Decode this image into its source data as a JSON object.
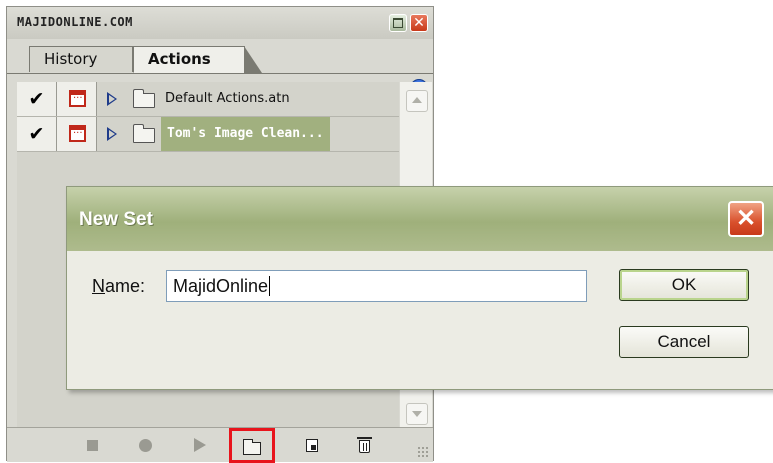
{
  "palette": {
    "title": "MAJIDONLINE.COM",
    "close_glyph": "✕",
    "tabs": [
      {
        "label": "History",
        "active": false
      },
      {
        "label": "Actions",
        "active": true
      }
    ],
    "rows": [
      {
        "checked": true,
        "check_glyph": "✔",
        "dialog_icon": "dialog-toggle-icon",
        "label": "Default Actions.atn",
        "selected": false
      },
      {
        "checked": true,
        "check_glyph": "✔",
        "dialog_icon": "dialog-toggle-icon",
        "label": "Tom's Image Clean...",
        "selected": true
      }
    ],
    "toolbar": [
      "stop-icon",
      "record-icon",
      "play-icon",
      "new-set-icon",
      "new-action-icon",
      "trash-icon"
    ],
    "highlight_color": "#e8141c",
    "selected_row_color": "#a1b07f"
  },
  "dialog": {
    "title": "New Set",
    "close_glyph": "✕",
    "name_label_prefix": "N",
    "name_label_rest": "ame:",
    "name_value": "MajidOnline",
    "ok_label": "OK",
    "cancel_label": "Cancel",
    "titlebar_color": "#9fb07b"
  }
}
